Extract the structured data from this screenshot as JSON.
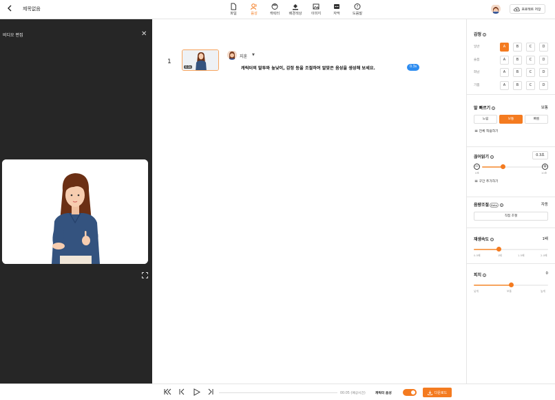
{
  "header": {
    "doc_title": "제목없음",
    "tabs": [
      {
        "label": "파일",
        "icon": "file-icon"
      },
      {
        "label": "음성",
        "icon": "voice-icon"
      },
      {
        "label": "캐릭터",
        "icon": "character-icon"
      },
      {
        "label": "배경색상",
        "icon": "paint-bucket-icon"
      },
      {
        "label": "이미지",
        "icon": "image-icon"
      },
      {
        "label": "자막",
        "icon": "subtitle-icon"
      },
      {
        "label": "도움말",
        "icon": "help-icon"
      }
    ],
    "active_tab": "음성",
    "project_button": "프로젝트 저장"
  },
  "left_panel": {
    "title": "비디오 편집"
  },
  "script": {
    "row_number": "1",
    "thumb_badge": "0.3s",
    "speaker_name": "지훈",
    "text": "캐릭터의 말투와 높낮이, 감정 등을 조절하여 알맞은 음성을 생성해 보세요.",
    "pause_chip": "0.3s"
  },
  "right_panel": {
    "emotion": {
      "title": "감정",
      "rows": [
        {
          "label": "일반",
          "options": [
            "A",
            "B",
            "C",
            "D"
          ],
          "selected": "A"
        },
        {
          "label": "슬픔",
          "options": [
            "A",
            "B",
            "C",
            "D"
          ],
          "selected": ""
        },
        {
          "label": "화남",
          "options": [
            "A",
            "B",
            "C",
            "D"
          ],
          "selected": ""
        },
        {
          "label": "기쁨",
          "options": [
            "A",
            "B",
            "C",
            "D"
          ],
          "selected": ""
        }
      ]
    },
    "speed": {
      "title": "말 빠르기",
      "value": "보통",
      "options": [
        "느림",
        "보통",
        "빠름"
      ],
      "selected": "보통",
      "apply_all": "전체 적용하기"
    },
    "pause": {
      "title": "끊어읽기",
      "value": "0.3초",
      "min_label": "0초",
      "max_label": "10초",
      "fraction": 0.34,
      "add_section": "구간 추가하기"
    },
    "volume": {
      "title": "음량조절",
      "beta": "Beta",
      "value": "자동",
      "button": "직접 조절"
    },
    "playback": {
      "title": "재생속도",
      "value": "1배",
      "ticks": [
        "0.5배",
        "1배",
        "1.5배",
        "2.0배"
      ],
      "fraction": 0.33
    },
    "pitch": {
      "title": "피치",
      "value": "0",
      "ticks": [
        "낮게",
        "보통",
        "높게"
      ],
      "fraction": 0.5
    }
  },
  "bottom": {
    "time": "00:05 (예상시간)",
    "character_voice_label": "캐릭터 음성",
    "character_voice_on": true,
    "download_button": "다운로드"
  },
  "colors": {
    "accent": "#f47b20",
    "pause_chip": "#2d8cf0",
    "left_panel_bg": "#262626"
  }
}
